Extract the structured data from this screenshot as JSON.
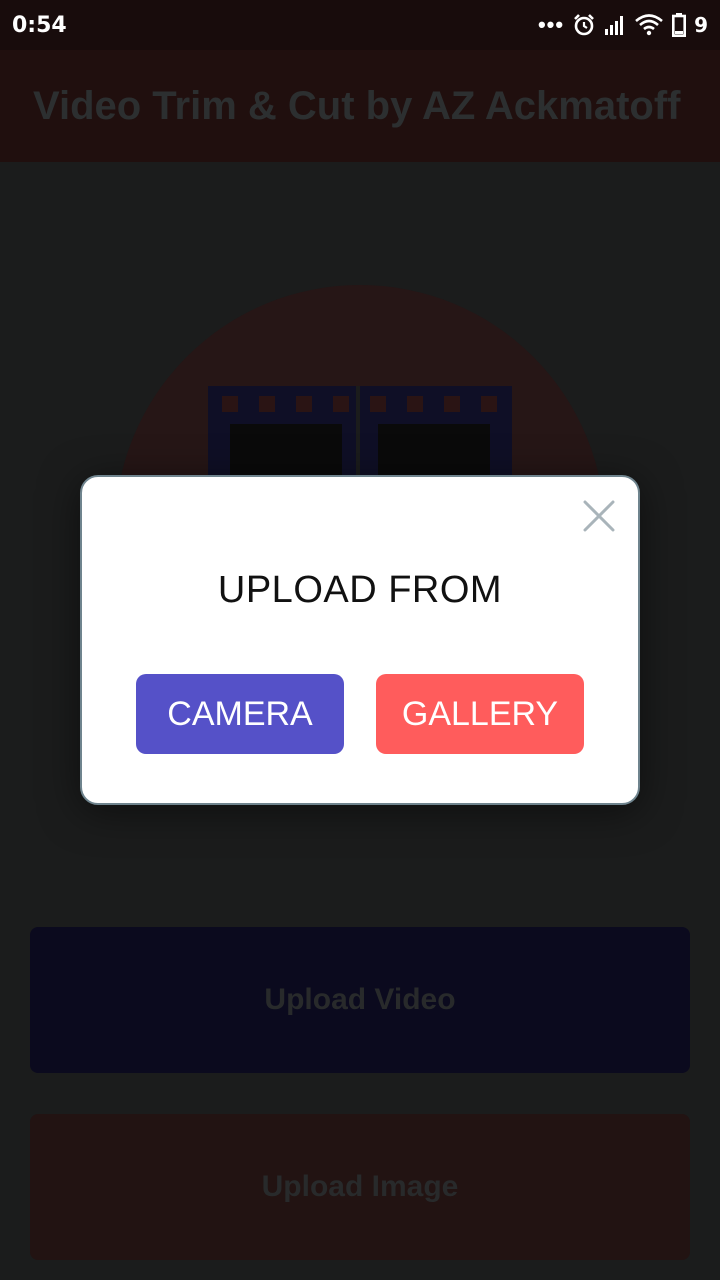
{
  "status_bar": {
    "time": "0:54",
    "dots": "•••",
    "battery_level": "9",
    "icons": [
      "alarm-icon",
      "signal-icon",
      "wifi-icon",
      "battery-icon"
    ]
  },
  "app": {
    "title": "Video Trim & Cut by AZ Ackmatoff",
    "upload_video_label": "Upload Video",
    "upload_image_label": "Upload Image"
  },
  "dialog": {
    "title": "UPLOAD FROM",
    "camera_label": "CAMERA",
    "gallery_label": "GALLERY",
    "close_icon": "close-icon"
  },
  "colors": {
    "camera_button": "#5551c8",
    "gallery_button": "#ff5c5c",
    "dialog_border": "#6f848e",
    "close_icon": "#a9b4ba"
  }
}
